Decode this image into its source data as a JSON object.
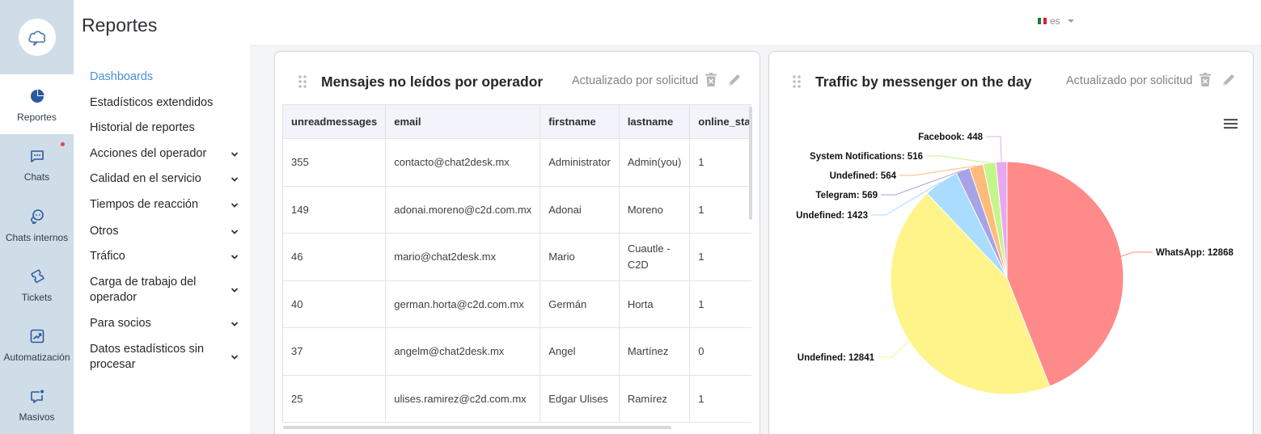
{
  "rail": {
    "items": [
      {
        "label": "Reportes"
      },
      {
        "label": "Chats"
      },
      {
        "label": "Chats internos"
      },
      {
        "label": "Tickets"
      },
      {
        "label": "Automatización"
      },
      {
        "label": "Masivos"
      }
    ]
  },
  "menu": {
    "title": "Reportes",
    "items": [
      {
        "label": "Dashboards"
      },
      {
        "label": "Estadísticos extendidos"
      },
      {
        "label": "Historial de reportes"
      },
      {
        "label": "Acciones del operador"
      },
      {
        "label": "Calidad en el servicio"
      },
      {
        "label": "Tiempos de reacción"
      },
      {
        "label": "Otros"
      },
      {
        "label": "Tráfico"
      },
      {
        "label": "Carga de trabajo del operador"
      },
      {
        "label": "Para socios"
      },
      {
        "label": "Datos estadísticos sin procesar"
      }
    ]
  },
  "topbar": {
    "lang": "es"
  },
  "card1": {
    "title": "Mensajes no leídos por operador",
    "status": "Actualizado por solicitud",
    "columns": [
      "unreadmessages",
      "email",
      "firstname",
      "lastname",
      "online_status"
    ],
    "rows": [
      [
        "355",
        "contacto@chat2desk.mx",
        "Administrator",
        "Admin(you)",
        "1"
      ],
      [
        "149",
        "adonai.moreno@c2d.com.mx",
        "Adonai",
        "Moreno",
        "1"
      ],
      [
        "46",
        "mario@chat2desk.mx",
        "Mario",
        "Cuautle - C2D",
        "1"
      ],
      [
        "40",
        "german.horta@c2d.com.mx",
        "Germán",
        "Horta",
        "1"
      ],
      [
        "37",
        "angelm@chat2desk.mx",
        "Angel",
        "Martínez",
        "0"
      ],
      [
        "25",
        "ulises.ramirez@c2d.com.mx",
        "Edgar Ulises",
        "Ramírez",
        "1"
      ]
    ]
  },
  "card2": {
    "title": "Traffic by messenger on the day",
    "status": "Actualizado por solicitud"
  },
  "chart_data": {
    "type": "pie",
    "categories": [
      "WhatsApp",
      "Undefined",
      "Undefined",
      "Telegram",
      "Undefined",
      "System Notifications",
      "Facebook"
    ],
    "values": [
      12868,
      12841,
      1423,
      569,
      564,
      516,
      448
    ],
    "labels": [
      "WhatsApp: 12868",
      "Undefined: 12841",
      "Undefined: 1423",
      "Telegram: 569",
      "Undefined: 564",
      "System Notifications: 516",
      "Facebook: 448"
    ],
    "colors": [
      "#ff8a8a",
      "#fff48a",
      "#a9dcff",
      "#a8a3e6",
      "#ffbb7a",
      "#c4f58a",
      "#e8a8ef"
    ],
    "legend": "none"
  }
}
